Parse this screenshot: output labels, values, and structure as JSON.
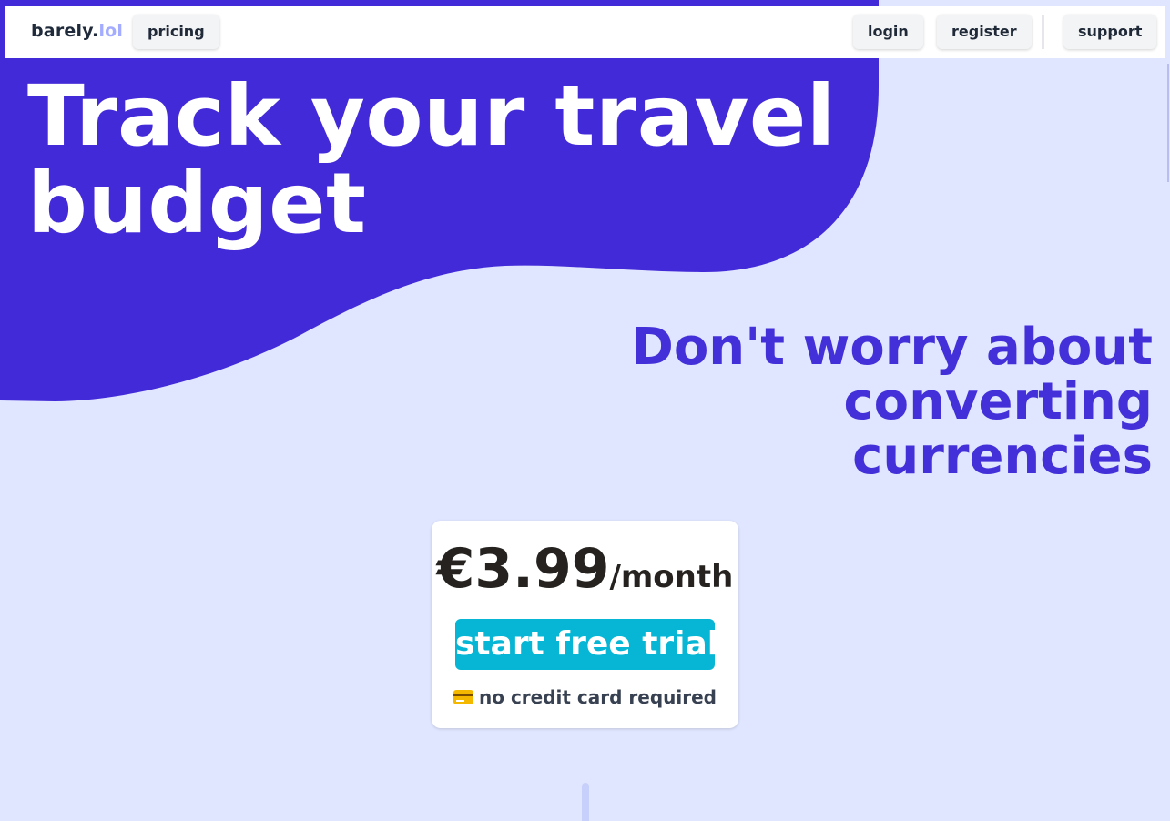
{
  "brand": {
    "name": "barely.",
    "suffix": "lol"
  },
  "nav": {
    "pricing": "pricing",
    "login": "login",
    "register": "register",
    "support": "support"
  },
  "hero": {
    "title": "Track your travel budget",
    "subtitle": "Don't worry about converting currencies"
  },
  "pricing_card": {
    "price": "€3.99",
    "period": "/month",
    "cta": "start free trial",
    "note": "no credit card required",
    "note_icon": "credit-card-icon"
  },
  "colors": {
    "background": "#e0e6ff",
    "hero_blob": "#432ad8",
    "subtitle": "#4430d8",
    "cta": "#06b6d4",
    "brand_accent": "#a3acff"
  }
}
